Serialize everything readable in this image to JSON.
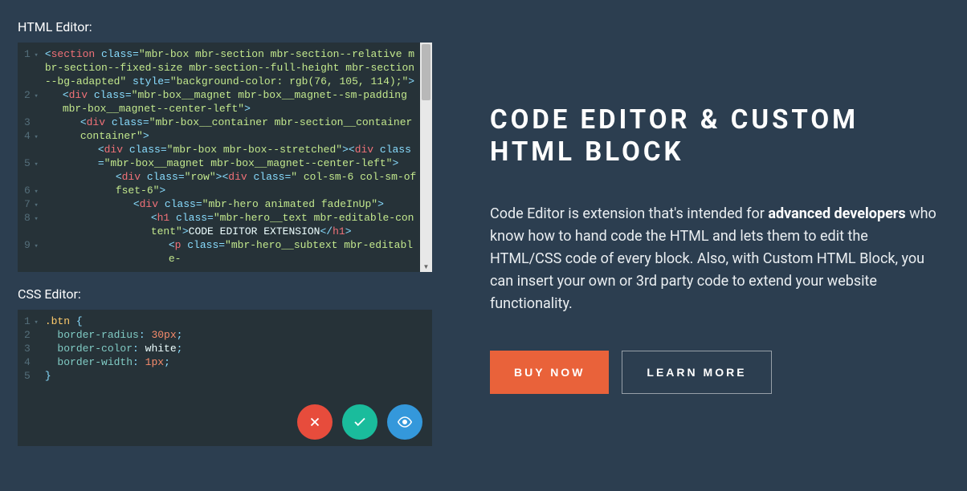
{
  "editor": {
    "html_title": "HTML Editor:",
    "css_title": "CSS Editor:",
    "html_lines": [
      {
        "n": "1",
        "fold": true,
        "indent": 0,
        "parts": [
          {
            "t": "<",
            "c": "punc"
          },
          {
            "t": "section",
            "c": "tag"
          },
          {
            "t": " class=",
            "c": "punc"
          },
          {
            "t": "\"mbr-box mbr-section mbr-section--relative mbr-section--fixed-size mbr-section--full-height mbr-section--bg-adapted\"",
            "c": "attr"
          },
          {
            "t": " style=",
            "c": "punc"
          },
          {
            "t": "\"background-color: rgb(76, 105, 114);\"",
            "c": "attr"
          },
          {
            "t": ">",
            "c": "punc"
          }
        ]
      },
      {
        "n": "2",
        "fold": true,
        "indent": 1,
        "parts": [
          {
            "t": "<",
            "c": "punc"
          },
          {
            "t": "div",
            "c": "tag"
          },
          {
            "t": " class=",
            "c": "punc"
          },
          {
            "t": "\"mbr-box__magnet mbr-box__magnet--sm-padding mbr-box__magnet--center-left\"",
            "c": "attr"
          },
          {
            "t": ">",
            "c": "punc"
          }
        ]
      },
      {
        "n": "3",
        "fold": false,
        "indent": 0,
        "parts": []
      },
      {
        "n": "4",
        "fold": true,
        "indent": 2,
        "parts": [
          {
            "t": "<",
            "c": "punc"
          },
          {
            "t": "div",
            "c": "tag"
          },
          {
            "t": " class=",
            "c": "punc"
          },
          {
            "t": "\"mbr-box__container mbr-section__container container\"",
            "c": "attr"
          },
          {
            "t": ">",
            "c": "punc"
          }
        ]
      },
      {
        "n": "5",
        "fold": true,
        "indent": 3,
        "parts": [
          {
            "t": "<",
            "c": "punc"
          },
          {
            "t": "div",
            "c": "tag"
          },
          {
            "t": " class=",
            "c": "punc"
          },
          {
            "t": "\"mbr-box mbr-box--stretched\"",
            "c": "attr"
          },
          {
            "t": "><",
            "c": "punc"
          },
          {
            "t": "div",
            "c": "tag"
          },
          {
            "t": " class=",
            "c": "punc"
          },
          {
            "t": "\"mbr-box__magnet mbr-box__magnet--center-left\"",
            "c": "attr"
          },
          {
            "t": ">",
            "c": "punc"
          }
        ]
      },
      {
        "n": "6",
        "fold": true,
        "indent": 4,
        "parts": [
          {
            "t": "<",
            "c": "punc"
          },
          {
            "t": "div",
            "c": "tag"
          },
          {
            "t": " class=",
            "c": "punc"
          },
          {
            "t": "\"row\"",
            "c": "attr"
          },
          {
            "t": "><",
            "c": "punc"
          },
          {
            "t": "div",
            "c": "tag"
          },
          {
            "t": " class=",
            "c": "punc"
          },
          {
            "t": "\" col-sm-6 col-sm-offset-6\"",
            "c": "attr"
          },
          {
            "t": ">",
            "c": "punc"
          }
        ]
      },
      {
        "n": "7",
        "fold": true,
        "indent": 5,
        "parts": [
          {
            "t": "<",
            "c": "punc"
          },
          {
            "t": "div",
            "c": "tag"
          },
          {
            "t": " class=",
            "c": "punc"
          },
          {
            "t": "\"mbr-hero animated fadeInUp\"",
            "c": "attr"
          },
          {
            "t": ">",
            "c": "punc"
          }
        ]
      },
      {
        "n": "8",
        "fold": true,
        "indent": 6,
        "parts": [
          {
            "t": "<",
            "c": "punc"
          },
          {
            "t": "h1",
            "c": "tag"
          },
          {
            "t": " class=",
            "c": "punc"
          },
          {
            "t": "\"mbr-hero__text mbr-editable-content\"",
            "c": "attr"
          },
          {
            "t": ">",
            "c": "punc"
          },
          {
            "t": "CODE EDITOR EXTENSION",
            "c": "text"
          },
          {
            "t": "</",
            "c": "punc"
          },
          {
            "t": "h1",
            "c": "tag"
          },
          {
            "t": ">",
            "c": "punc"
          }
        ]
      },
      {
        "n": "9",
        "fold": true,
        "indent": 7,
        "parts": [
          {
            "t": "<",
            "c": "punc"
          },
          {
            "t": "p",
            "c": "tag"
          },
          {
            "t": " class=",
            "c": "punc"
          },
          {
            "t": "\"mbr-hero__subtext mbr-editable-",
            "c": "attr"
          }
        ]
      }
    ],
    "css_lines": [
      {
        "n": "1",
        "fold": true,
        "parts": [
          {
            "t": ".btn",
            "c": "selector"
          },
          {
            "t": " {",
            "c": "punc"
          }
        ]
      },
      {
        "n": "2",
        "fold": false,
        "parts": [
          {
            "t": "  ",
            "c": "text"
          },
          {
            "t": "border-radius",
            "c": "prop"
          },
          {
            "t": ": ",
            "c": "punc"
          },
          {
            "t": "30px",
            "c": "propval"
          },
          {
            "t": ";",
            "c": "punc"
          }
        ]
      },
      {
        "n": "3",
        "fold": false,
        "parts": [
          {
            "t": "  ",
            "c": "text"
          },
          {
            "t": "border-color",
            "c": "prop"
          },
          {
            "t": ": ",
            "c": "punc"
          },
          {
            "t": "white",
            "c": "propvalw"
          },
          {
            "t": ";",
            "c": "punc"
          }
        ]
      },
      {
        "n": "4",
        "fold": false,
        "parts": [
          {
            "t": "  ",
            "c": "text"
          },
          {
            "t": "border-width",
            "c": "prop"
          },
          {
            "t": ": ",
            "c": "punc"
          },
          {
            "t": "1px",
            "c": "propval"
          },
          {
            "t": ";",
            "c": "punc"
          }
        ]
      },
      {
        "n": "5",
        "fold": false,
        "parts": [
          {
            "t": "}",
            "c": "punc"
          }
        ]
      }
    ],
    "buttons": {
      "cancel": "cancel",
      "accept": "accept",
      "preview": "preview"
    }
  },
  "content": {
    "heading": "CODE EDITOR & CUSTOM HTML BLOCK",
    "body_prefix": "Code Editor is extension that's intended for ",
    "body_bold": "advanced developers",
    "body_suffix": " who know how to hand code the HTML and lets them to edit the HTML/CSS code of every block. Also, with Custom HTML Block, you can insert your own or 3rd party code to extend your website functionality.",
    "btn_primary": "BUY NOW",
    "btn_secondary": "LEARN MORE"
  }
}
